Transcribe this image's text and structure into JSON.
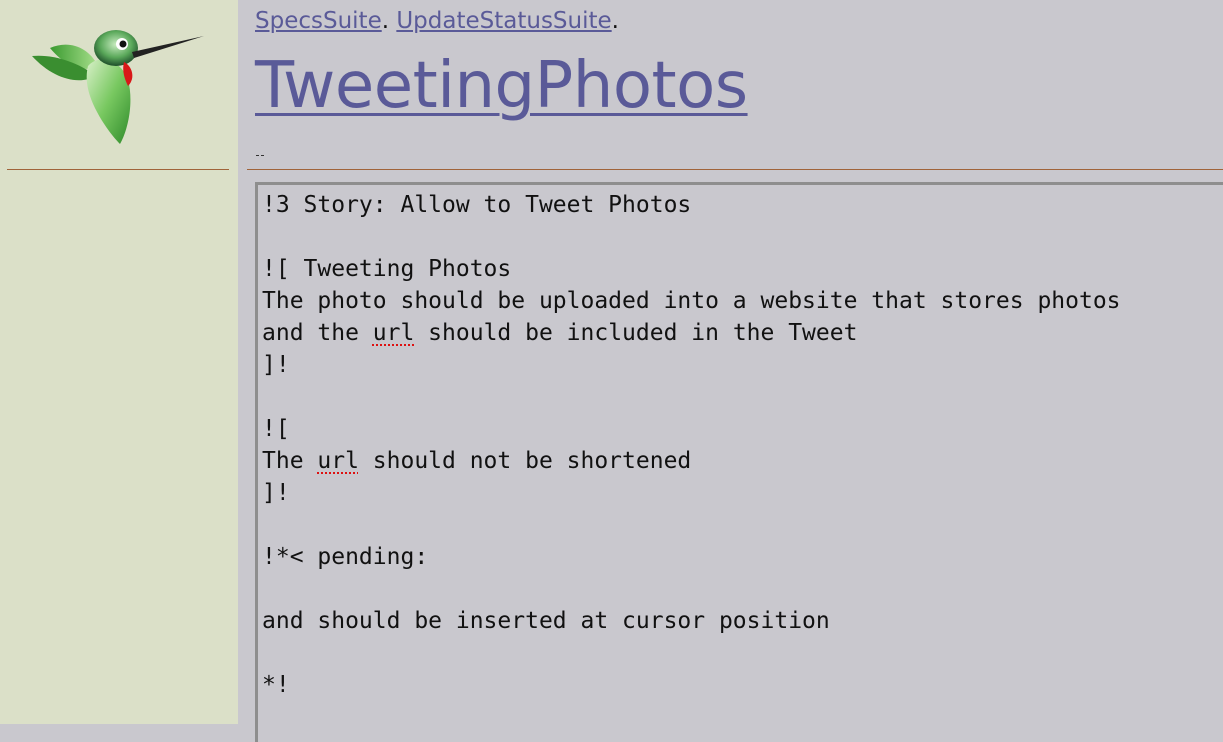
{
  "breadcrumb": {
    "items": [
      {
        "label": "SpecsSuite",
        "separator": "."
      },
      {
        "label": "UpdateStatusSuite",
        "separator": "."
      }
    ]
  },
  "page": {
    "title": "TweetingPhotos"
  },
  "editor": {
    "lines": [
      {
        "segments": [
          {
            "text": "!3 Story: Allow to Tweet Photos"
          }
        ]
      },
      {
        "segments": [
          {
            "text": ""
          }
        ]
      },
      {
        "segments": [
          {
            "text": "![ Tweeting Photos"
          }
        ]
      },
      {
        "segments": [
          {
            "text": "The photo should be uploaded into a website that stores photos"
          }
        ]
      },
      {
        "segments": [
          {
            "text": "and the "
          },
          {
            "text": "url",
            "spell": true
          },
          {
            "text": " should be included in the Tweet"
          }
        ]
      },
      {
        "segments": [
          {
            "text": "]!"
          }
        ]
      },
      {
        "segments": [
          {
            "text": ""
          }
        ]
      },
      {
        "segments": [
          {
            "text": "!["
          }
        ]
      },
      {
        "segments": [
          {
            "text": "The "
          },
          {
            "text": "url",
            "spell": true
          },
          {
            "text": " should not be shortened"
          }
        ]
      },
      {
        "segments": [
          {
            "text": "]!"
          }
        ]
      },
      {
        "segments": [
          {
            "text": ""
          }
        ]
      },
      {
        "segments": [
          {
            "text": "!*< pending:"
          }
        ]
      },
      {
        "segments": [
          {
            "text": ""
          }
        ]
      },
      {
        "segments": [
          {
            "text": "and should be inserted at cursor position"
          }
        ]
      },
      {
        "segments": [
          {
            "text": ""
          }
        ]
      },
      {
        "segments": [
          {
            "text": "*!"
          }
        ]
      }
    ]
  },
  "colors": {
    "link": "#5a5a98",
    "sidebar_bg": "#dbe0c8",
    "content_bg": "#c9c8ce",
    "rule": "#a0643a",
    "spellcheck": "#d11"
  },
  "icons": {
    "logo": "hummingbird-logo-icon"
  }
}
